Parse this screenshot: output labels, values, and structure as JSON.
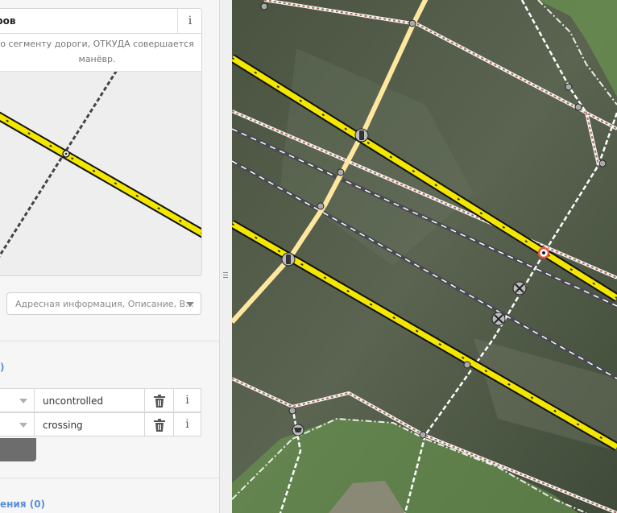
{
  "turn_panel": {
    "title": "ров",
    "description_line1": "о сегменту дороги, ОТКУДА совершается",
    "description_line2": "манёвр.",
    "info_glyph": "i"
  },
  "address_combo": {
    "placeholder": "Адресная информация, Описание, В..."
  },
  "tags_section": {
    "title": ")",
    "rows": [
      {
        "value": "uncontrolled",
        "delete_icon": "trash-icon",
        "info_glyph": "i"
      },
      {
        "value": "crossing",
        "delete_icon": "trash-icon",
        "info_glyph": "i"
      }
    ]
  },
  "relations_section": {
    "title": "ения (0)"
  },
  "colors": {
    "link_blue": "#5b8fd9",
    "primary_road": "#f3e700",
    "secondary_road": "#ffe7a0",
    "selected_vertex": "#e8553a",
    "green_area": "#6b9a4e"
  }
}
